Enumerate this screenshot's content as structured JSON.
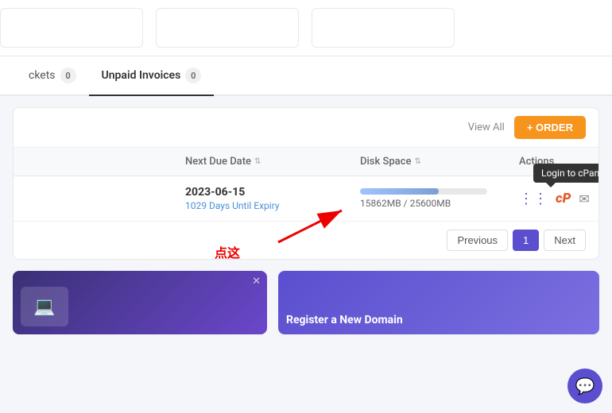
{
  "cards": [
    {
      "id": "card1"
    },
    {
      "id": "card2"
    },
    {
      "id": "card3"
    }
  ],
  "tabs": [
    {
      "label": "ckets",
      "badge": "0",
      "active": false
    },
    {
      "label": "Unpaid Invoices",
      "badge": "0",
      "active": true
    }
  ],
  "section": {
    "viewAll": "View All",
    "orderBtn": "+ ORDER"
  },
  "table": {
    "columns": [
      {
        "label": "Next Due Date"
      },
      {
        "label": "Disk Space"
      },
      {
        "label": "Actions"
      }
    ],
    "rows": [
      {
        "date": "2023-06-15",
        "expiry": "1029 Days Until Expiry",
        "diskUsed": "15862MB",
        "diskTotal": "25600MB",
        "diskPercent": 62
      }
    ]
  },
  "tooltip": "Login to cPanel",
  "pagination": {
    "prev": "Previous",
    "current": "1",
    "next": "Next"
  },
  "annotation": {
    "text": "点这"
  },
  "promo": [
    {
      "title": "Register a New Domain"
    }
  ],
  "chat": "💬"
}
